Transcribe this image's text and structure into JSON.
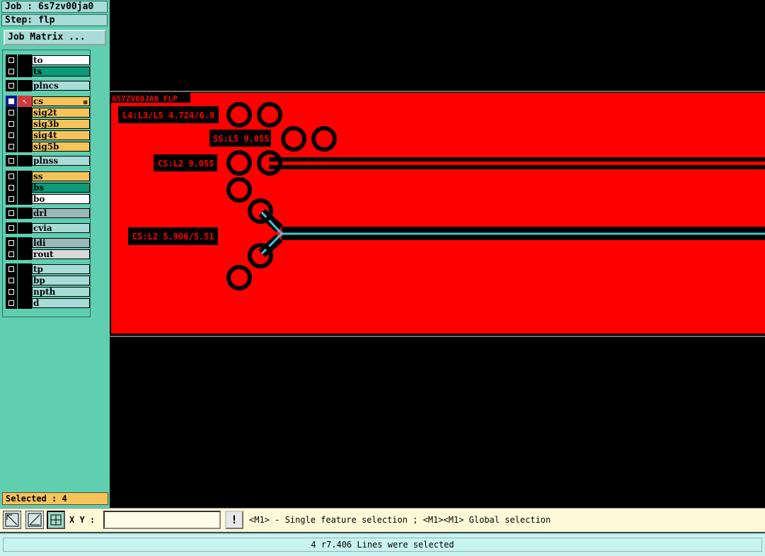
{
  "job": {
    "label": "Job : 6s7zv00ja0",
    "step": "Step: flp"
  },
  "job_matrix_label": "Job Matrix ...",
  "layers": [
    {
      "name": "to",
      "color": "#ffffff",
      "checked": false,
      "active": false
    },
    {
      "name": "ts",
      "color": "#0d9a78",
      "checked": false,
      "active": false
    },
    {
      "name": "plncs",
      "color": "#a8dcd8",
      "checked": false,
      "active": false
    },
    {
      "name": "cs",
      "color": "#f6c35a",
      "checked": true,
      "active": true,
      "mark": "⊞"
    },
    {
      "name": "sig2t",
      "color": "#f6c35a",
      "checked": false,
      "active": false
    },
    {
      "name": "sig3b",
      "color": "#f6c35a",
      "checked": false,
      "active": false
    },
    {
      "name": "sig4t",
      "color": "#f6c35a",
      "checked": false,
      "active": false
    },
    {
      "name": "sig5b",
      "color": "#f6c35a",
      "checked": false,
      "active": false
    },
    {
      "name": "plnss",
      "color": "#a8dcd8",
      "checked": false,
      "active": false
    },
    {
      "name": "ss",
      "color": "#f6c35a",
      "checked": false,
      "active": false
    },
    {
      "name": "bs",
      "color": "#0d9a78",
      "checked": false,
      "active": false
    },
    {
      "name": "bo",
      "color": "#ffffff",
      "checked": false,
      "active": false
    },
    {
      "name": "drl",
      "color": "#9ab8b8",
      "checked": false,
      "active": false
    },
    {
      "name": "cvia",
      "color": "#a8dcd8",
      "checked": false,
      "active": false
    },
    {
      "name": "ldi",
      "color": "#9ab8b8",
      "checked": false,
      "active": false
    },
    {
      "name": "rout",
      "color": "#d8d8d8",
      "checked": false,
      "active": false
    },
    {
      "name": "tp",
      "color": "#a8dcd8",
      "checked": false,
      "active": false
    },
    {
      "name": "bp",
      "color": "#a8dcd8",
      "checked": false,
      "active": false
    },
    {
      "name": "npth",
      "color": "#a8dcd8",
      "checked": false,
      "active": false
    },
    {
      "name": "d",
      "color": "#a8dcd8",
      "checked": false,
      "active": false
    }
  ],
  "selected_label": "Selected : 4",
  "canvas": {
    "title": "6S7ZV00JA0 FLP",
    "annotations": [
      "L4:L3/L5 4.724/6.9",
      "SS:L5 9.055",
      "CS:L2 9.055",
      "CS:L2 5.906/5.51"
    ],
    "board_color": "#ff0000",
    "trace_color": "#000000",
    "selected_color": "#40c8d8"
  },
  "toolbar": {
    "xy_label": "X Y :",
    "xy_value": "",
    "prompt": "<M1> - Single feature selection ; <M1><M1> Global selection",
    "warn_label": "!"
  },
  "status": "4 r7.406 Lines were selected"
}
